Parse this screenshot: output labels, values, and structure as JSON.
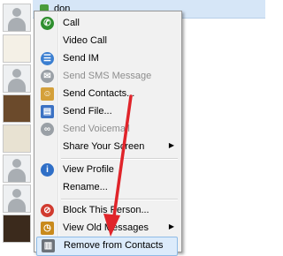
{
  "top_contact": {
    "name": "don"
  },
  "menu": {
    "items": [
      {
        "label": "Call",
        "icon": "phone-icon",
        "color": "#2f8f2f",
        "glyph": "✆",
        "enabled": true
      },
      {
        "label": "Video Call",
        "icon": "",
        "color": "",
        "glyph": "",
        "enabled": true
      },
      {
        "label": "Send IM",
        "icon": "chat-icon",
        "color": "#3b7fd1",
        "glyph": "☰",
        "enabled": true
      },
      {
        "label": "Send SMS Message",
        "icon": "sms-icon",
        "color": "#9aa0a6",
        "glyph": "✉",
        "enabled": false
      },
      {
        "label": "Send Contacts...",
        "icon": "contacts-icon",
        "color": "#d4a03a",
        "glyph": "☺",
        "enabled": true
      },
      {
        "label": "Send File...",
        "icon": "file-icon",
        "color": "#3c72c4",
        "glyph": "▤",
        "enabled": true
      },
      {
        "label": "Send Voicemail",
        "icon": "voicemail-icon",
        "color": "#9aa0a6",
        "glyph": "∞",
        "enabled": false
      },
      {
        "label": "Share Your Screen",
        "icon": "",
        "color": "",
        "glyph": "",
        "enabled": true,
        "submenu": true
      },
      {
        "label": "View Profile",
        "icon": "info-icon",
        "color": "#2f6fc7",
        "glyph": "i",
        "enabled": true
      },
      {
        "label": "Rename...",
        "icon": "",
        "color": "",
        "glyph": "",
        "enabled": true
      },
      {
        "label": "Block This Person...",
        "icon": "block-icon",
        "color": "#d13b2f",
        "glyph": "⊘",
        "enabled": true
      },
      {
        "label": "View Old Messages",
        "icon": "clock-icon",
        "color": "#c98a1c",
        "glyph": "◷",
        "enabled": true,
        "submenu": true
      },
      {
        "label": "Remove from Contacts",
        "icon": "trash-icon",
        "color": "#6d737a",
        "glyph": "▥",
        "enabled": true,
        "highlighted": true
      }
    ],
    "submenu_arrow": "▶"
  },
  "colors": {
    "menu_bg": "#f1f1f1",
    "highlight": "#dcebfb",
    "arrow": "#e0242a"
  }
}
